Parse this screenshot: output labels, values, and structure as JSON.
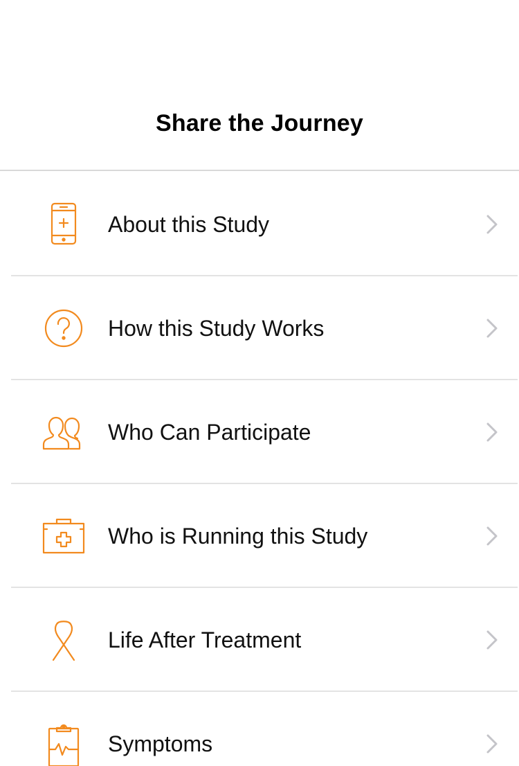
{
  "header": {
    "title": "Share the Journey"
  },
  "colors": {
    "accent": "#f28a1e",
    "chevron": "#c4c4c9",
    "separator": "#e3e3e3"
  },
  "menu": {
    "items": [
      {
        "label": "About this Study",
        "icon": "phone-plus-icon"
      },
      {
        "label": "How this Study Works",
        "icon": "question-circle-icon"
      },
      {
        "label": "Who Can Participate",
        "icon": "people-icon"
      },
      {
        "label": "Who is Running this Study",
        "icon": "medical-kit-icon"
      },
      {
        "label": "Life After Treatment",
        "icon": "ribbon-icon"
      },
      {
        "label": "Symptoms",
        "icon": "clipboard-pulse-icon"
      }
    ]
  }
}
